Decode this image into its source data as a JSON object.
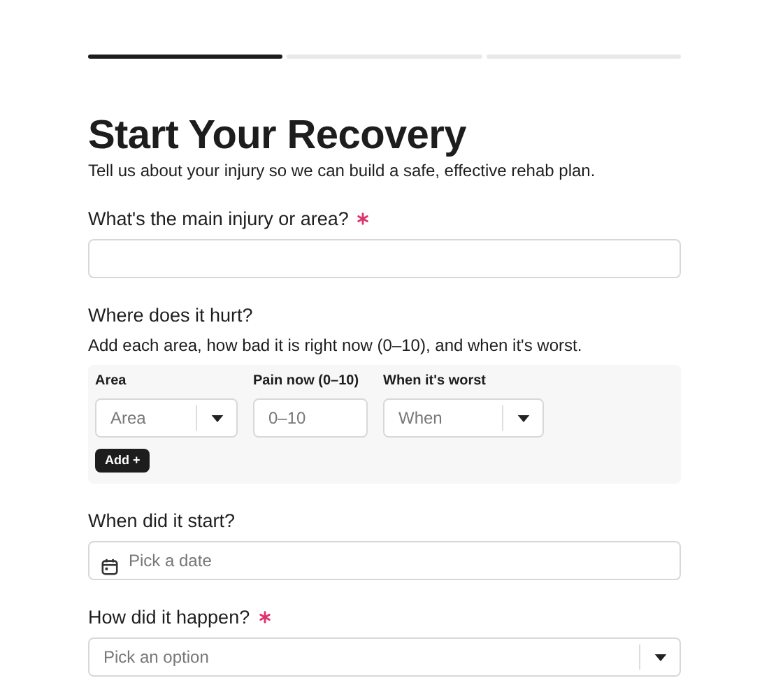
{
  "progress": [
    {
      "complete": true
    },
    {
      "complete": false
    },
    {
      "complete": false
    }
  ],
  "title": "Start Your Recovery",
  "subtitle": "Tell us about your injury so we can build a safe, effective rehab plan.",
  "sections": [
    {
      "kind": "text",
      "label": "What's the main injury or area?",
      "required": true
    },
    {
      "kind": "repeater",
      "label": "Where does it hurt?",
      "help": "Add each area, how bad it is right now (0–10), and when it's worst.",
      "columns": [
        {
          "label": "Area",
          "kind": "select",
          "placeholder": "Area"
        },
        {
          "label": "Pain now (0–10)",
          "kind": "text",
          "placeholder": "0–10"
        },
        {
          "label": "When it's worst",
          "kind": "select",
          "placeholder": "When"
        }
      ],
      "add_button": "Add +"
    },
    {
      "kind": "date",
      "label": "When did it start?",
      "placeholder": "Pick a date"
    },
    {
      "kind": "select",
      "label": "How did it happen?",
      "required": true,
      "placeholder": "Pick an option"
    }
  ]
}
